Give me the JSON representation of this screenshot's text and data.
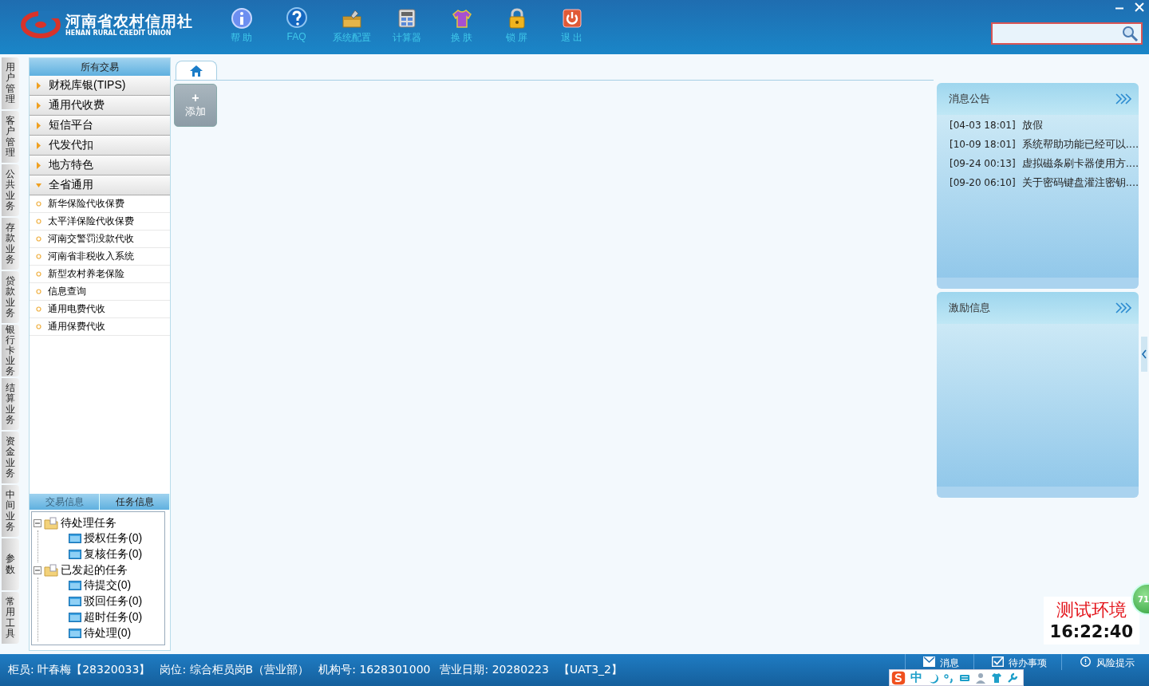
{
  "header": {
    "logo_cn": "河南省农村信用社",
    "logo_en": "HENAN RURAL CREDIT UNION",
    "toolbar": [
      {
        "label": "帮 助",
        "kind": "info"
      },
      {
        "label": "FAQ",
        "kind": "faq"
      },
      {
        "label": "系统配置",
        "kind": "config"
      },
      {
        "label": "计算器",
        "kind": "calc"
      },
      {
        "label": "换 肤",
        "kind": "skin"
      },
      {
        "label": "锁 屏",
        "kind": "lock"
      },
      {
        "label": "退 出",
        "kind": "exit"
      }
    ]
  },
  "side_tabs": [
    "用户管理",
    "客户管理",
    "公共业务",
    "存款业务",
    "贷款业务",
    "银行卡业务",
    "结算业务",
    "资金业务",
    "中间业务",
    "参数",
    "常用工具"
  ],
  "sidebar": {
    "title": "所有交易",
    "groups": [
      {
        "label": "财税库银(TIPS)",
        "expanded": false
      },
      {
        "label": "通用代收费",
        "expanded": false
      },
      {
        "label": "短信平台",
        "expanded": false
      },
      {
        "label": "代发代扣",
        "expanded": false
      },
      {
        "label": "地方特色",
        "expanded": false
      },
      {
        "label": "全省通用",
        "expanded": true,
        "children": [
          "新华保险代收保费",
          "太平洋保险代收保费",
          "河南交警罚没款代收",
          "河南省非税收入系统",
          "新型农村养老保险",
          "信息查询",
          "通用电费代收",
          "通用保费代收"
        ]
      }
    ],
    "bottom_tabs": [
      {
        "label": "交易信息",
        "selected": false
      },
      {
        "label": "任务信息",
        "selected": true
      }
    ],
    "tree": [
      {
        "label": "待处理任务",
        "expanded": true,
        "children": [
          {
            "label": "授权任务(0)"
          },
          {
            "label": "复核任务(0)"
          }
        ]
      },
      {
        "label": "已发起的任务",
        "expanded": true,
        "children": [
          {
            "label": "待提交(0)"
          },
          {
            "label": "驳回任务(0)"
          },
          {
            "label": "超时任务(0)"
          },
          {
            "label": "待处理(0)"
          }
        ]
      }
    ]
  },
  "main": {
    "tabs": [
      {
        "kind": "home",
        "selected": true
      }
    ],
    "add_button": {
      "icon": "+",
      "label": "添加"
    }
  },
  "panels": [
    {
      "title": "消息公告",
      "items": [
        {
          "time": "[04-03 18:01]",
          "text": "放假"
        },
        {
          "time": "[10-09 18:01]",
          "text": "系统帮助功能已经可以...."
        },
        {
          "time": "[09-24 00:13]",
          "text": "虚拟磁条刷卡器使用方...."
        },
        {
          "time": "[09-20 06:10]",
          "text": "关于密码键盘灌注密钥...."
        }
      ]
    },
    {
      "title": "激励信息"
    }
  ],
  "environment": {
    "label": "测试环境",
    "time": "16:22:40"
  },
  "float_ball": "71",
  "status_bar": {
    "info": [
      "柜员: 叶春梅【28320033】",
      "岗位: 综合柜员岗B（营业部）",
      "机构号: 1628301000",
      "营业日期: 20280223",
      "【UAT3_2】"
    ],
    "buttons": [
      {
        "label": "消息",
        "kind": "mail"
      },
      {
        "label": "待办事项",
        "kind": "todo"
      },
      {
        "label": "风险提示",
        "kind": "risk"
      }
    ]
  },
  "ime_bar": {
    "label": "中"
  }
}
